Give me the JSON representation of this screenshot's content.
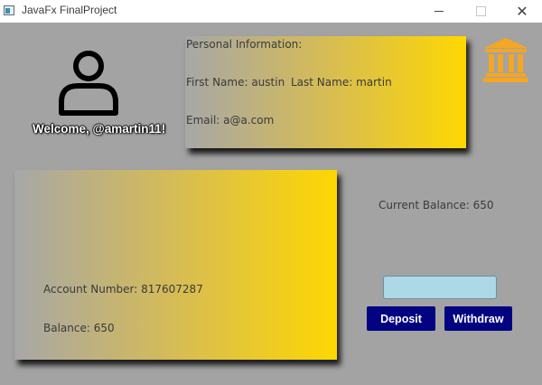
{
  "window": {
    "title": "JavaFx FinalProject"
  },
  "profile": {
    "welcome": "Welcome, @amartin11!",
    "avatar_icon": "user-icon"
  },
  "personal_info": {
    "heading": "Personal Information:",
    "first_name": "First Name: austin",
    "last_name": "Last Name: martin",
    "email": "Email: a@a.com"
  },
  "bank_icon": "bank-icon",
  "account": {
    "number": "Account Number: 817607287",
    "balance": "Balance: 650"
  },
  "current_balance": "Current Balance: 650",
  "amount_input": {
    "value": "",
    "placeholder": ""
  },
  "buttons": {
    "deposit": "Deposit",
    "withdraw": "Withdraw"
  },
  "colors": {
    "background": "#a3a3a3",
    "card_gradient_start": "#a7a7a7",
    "card_gradient_end": "#fed702",
    "button": "#020380",
    "input": "#add8e6",
    "bank_icon": "#f5a623"
  }
}
